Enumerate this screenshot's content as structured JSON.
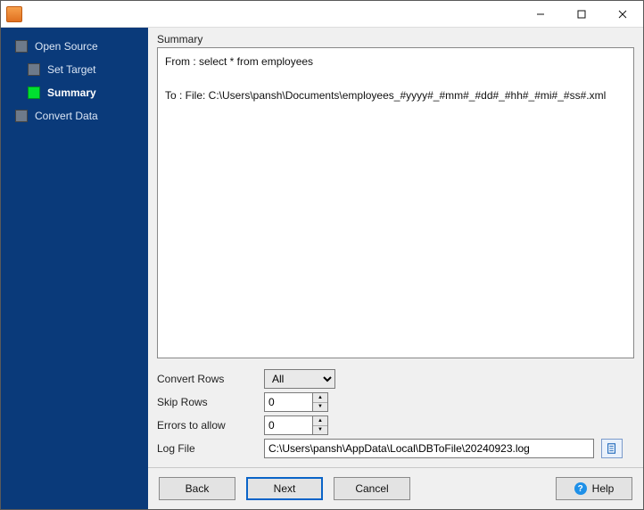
{
  "window": {
    "title": ""
  },
  "sidebar": {
    "items": [
      {
        "label": "Open Source",
        "sub": false,
        "active": false
      },
      {
        "label": "Set Target",
        "sub": true,
        "active": false
      },
      {
        "label": "Summary",
        "sub": true,
        "active": true
      },
      {
        "label": "Convert Data",
        "sub": false,
        "active": false
      }
    ]
  },
  "summary": {
    "heading": "Summary",
    "from_line": "From : select * from employees",
    "to_line": "To : File: C:\\Users\\pansh\\Documents\\employees_#yyyy#_#mm#_#dd#_#hh#_#mi#_#ss#.xml"
  },
  "form": {
    "convert_rows": {
      "label": "Convert Rows",
      "value": "All"
    },
    "skip_rows": {
      "label": "Skip Rows",
      "value": "0"
    },
    "errors_allow": {
      "label": "Errors to allow",
      "value": "0"
    },
    "log_file": {
      "label": "Log File",
      "value": "C:\\Users\\pansh\\AppData\\Local\\DBToFile\\20240923.log"
    }
  },
  "footer": {
    "back": "Back",
    "next": "Next",
    "cancel": "Cancel",
    "help": "Help"
  }
}
